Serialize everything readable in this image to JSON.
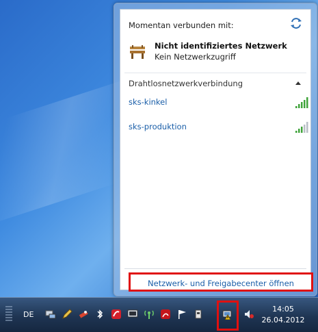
{
  "popup": {
    "connected_label": "Momentan verbunden mit:",
    "current_network": {
      "name": "Nicht identifiziertes Netzwerk",
      "status": "Kein Netzwerkzugriff",
      "icon": "bench-icon"
    },
    "section_title": "Drahtlosnetzwerkverbindung",
    "wifi_networks": [
      {
        "name": "sks-kinkel",
        "signal": 5
      },
      {
        "name": "sks-produktion",
        "signal": 3
      }
    ],
    "footer_link": "Netzwerk- und Freigabecenter öffnen"
  },
  "taskbar": {
    "language": "DE",
    "clock_time": "14:05",
    "clock_date": "26.04.2012",
    "tray_icons": [
      "network-config-icon",
      "pencil-icon",
      "tool-icon",
      "bluetooth-icon",
      "antivirus-icon",
      "monitor-icon",
      "wireless-icon",
      "pdf-icon",
      "flag-icon",
      "device-icon",
      "network-tray-icon",
      "volume-icon"
    ]
  },
  "colors": {
    "highlight": "#e01010",
    "link": "#1a5ea8",
    "signal_active": "#3fa33a",
    "signal_inactive": "#b8bec6"
  }
}
